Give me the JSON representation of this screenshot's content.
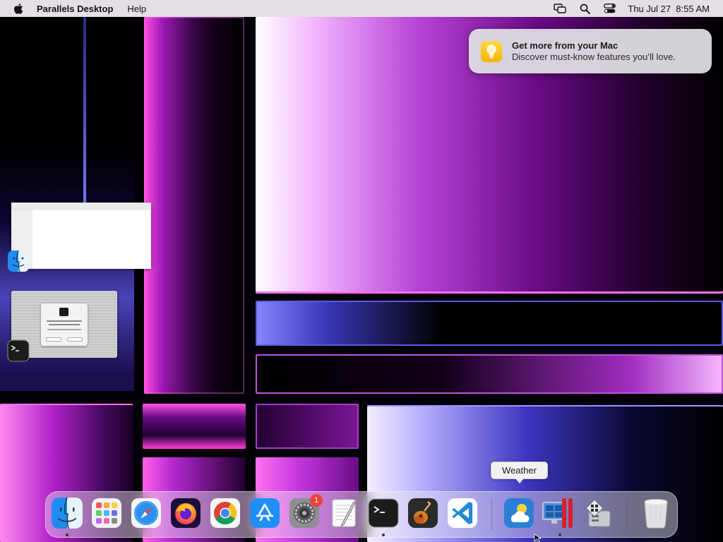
{
  "menubar": {
    "apple_icon": "apple-icon",
    "app_name": "Parallels Desktop",
    "items": [
      "Help"
    ],
    "status_icons": [
      "screen-mirroring-icon",
      "search-icon",
      "control-center-icon"
    ],
    "clock": "Thu Jul 27  8:55 AM"
  },
  "notification": {
    "icon": "lightbulb-icon",
    "title": "Get more from your Mac",
    "body": "Discover must-know features you’ll love."
  },
  "desktop": {
    "minimized_windows": [
      {
        "app": "Finder",
        "icon": "finder-icon"
      },
      {
        "app": "Terminal",
        "icon": "terminal-icon"
      }
    ]
  },
  "tooltip": {
    "text": "Weather"
  },
  "dock": {
    "apps": [
      {
        "name": "Finder",
        "icon": "finder-icon",
        "running": true
      },
      {
        "name": "Launchpad",
        "icon": "launchpad-icon",
        "running": false
      },
      {
        "name": "Safari",
        "icon": "safari-icon",
        "running": false
      },
      {
        "name": "Firefox",
        "icon": "firefox-icon",
        "running": false
      },
      {
        "name": "Google Chrome",
        "icon": "chrome-icon",
        "running": false
      },
      {
        "name": "App Store",
        "icon": "app-store-icon",
        "running": false
      },
      {
        "name": "System Settings",
        "icon": "system-settings-icon",
        "running": false,
        "badge": "1"
      },
      {
        "name": "TextEdit",
        "icon": "textedit-icon",
        "running": false
      },
      {
        "name": "Terminal",
        "icon": "terminal-icon",
        "running": true
      },
      {
        "name": "GarageBand",
        "icon": "garageband-icon",
        "running": false
      },
      {
        "name": "Visual Studio Code",
        "icon": "vscode-icon",
        "running": false
      },
      {
        "name": "Weather",
        "icon": "weather-icon",
        "running": false
      },
      {
        "name": "Parallels Desktop",
        "icon": "parallels-icon",
        "running": true
      },
      {
        "name": "Boot Camp Assistant",
        "icon": "bootcamp-icon",
        "running": false
      },
      {
        "name": "Trash",
        "icon": "trash-icon",
        "running": false
      }
    ]
  },
  "colors": {
    "accent_badge": "#f0413c",
    "menubar_bg": "#ece8ee"
  }
}
